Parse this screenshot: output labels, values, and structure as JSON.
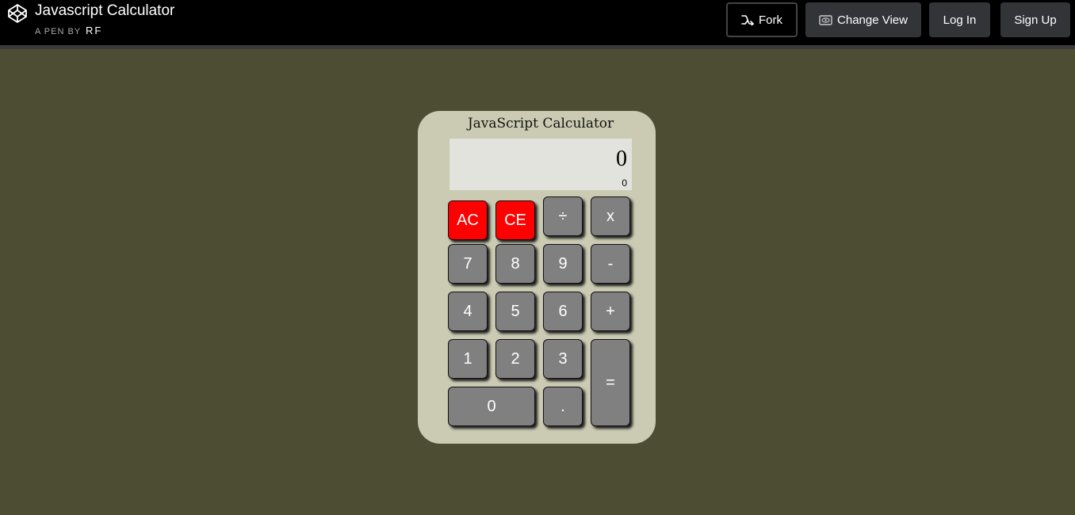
{
  "header": {
    "title": "Javascript Calculator",
    "by_label": "A PEN BY",
    "author": "RF",
    "fork_label": "Fork",
    "change_view_label": "Change View",
    "login_label": "Log In",
    "signup_label": "Sign Up"
  },
  "calculator": {
    "title": "JavaScript Calculator",
    "display": {
      "main": "0",
      "sub": "0"
    },
    "keys": {
      "ac": "AC",
      "ce": "CE",
      "divide": "÷",
      "multiply": "x",
      "seven": "7",
      "eight": "8",
      "nine": "9",
      "minus": "-",
      "four": "4",
      "five": "5",
      "six": "6",
      "plus": "+",
      "one": "1",
      "two": "2",
      "three": "3",
      "equals": "=",
      "zero": "0",
      "decimal": "."
    }
  },
  "colors": {
    "page_background": "#4d4d33",
    "calculator_body": "#cbcbb3",
    "display_background": "#e3e3de",
    "key_gray": "#808080",
    "key_red": "#ff0000"
  },
  "icons": {
    "logo": "codepen-logo-icon",
    "fork": "fork-icon",
    "change_view": "eye-icon"
  }
}
